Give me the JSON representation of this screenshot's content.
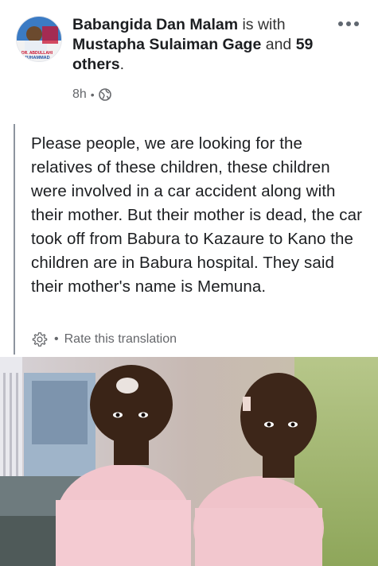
{
  "post": {
    "author": "Babangida Dan Malam",
    "is_with": "is with",
    "tagged": "Mustapha Sulaiman Gage",
    "and": "and",
    "others": "59 others",
    "period": ".",
    "time": "8h",
    "separator": "•",
    "privacy_icon": "globe-icon",
    "more_icon": "more-horizontal-icon"
  },
  "avatar": {
    "caption_line1": "DR. ABDULLAHI",
    "caption_line2": "MUHAMMAD"
  },
  "translation": {
    "text": "Please people, we are looking for the relatives of these children, these children were involved in a car accident along with their mother. But their mother is dead, the car took off from Babura to Kazaure to Kano the children are in Babura hospital. They said their mother's name is Memuna.",
    "separator": "•",
    "rate_label": "Rate this translation",
    "settings_icon": "gear-icon"
  },
  "colors": {
    "text_primary": "#1c1e21",
    "text_secondary": "#65676b",
    "border": "#8d949e"
  }
}
